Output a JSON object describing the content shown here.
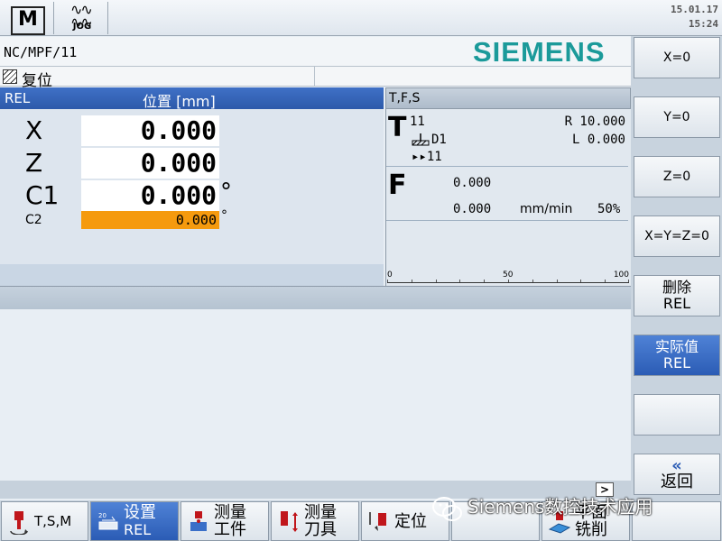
{
  "status": {
    "mode_icon": "M",
    "jog_label": "JOG",
    "date": "15.01.17",
    "time": "15:24"
  },
  "program": {
    "path": "NC/MPF/11",
    "brand": "SIEMENS",
    "reset_label": "复位"
  },
  "position": {
    "header_label": "REL",
    "header_unit": "位置 [mm]",
    "axes": [
      {
        "name": "X",
        "value": "0.000",
        "unit": ""
      },
      {
        "name": "Z",
        "value": "0.000",
        "unit": ""
      },
      {
        "name": "C1",
        "value": "0.000",
        "unit": "°"
      }
    ],
    "c2": {
      "name": "C2",
      "value": "0.000",
      "unit": "°"
    }
  },
  "tfs": {
    "header": "T,F,S",
    "t_letter": "T",
    "tool_number": "11",
    "edge": "D1",
    "next_tool": "▸▸11",
    "radius": "R 10.000",
    "length": "L  0.000",
    "f_letter": "F",
    "feed_actual": "0.000",
    "feed_set": "0.000",
    "feed_unit": "mm/min",
    "feed_override": "50%",
    "scale": {
      "min": "0",
      "mid": "50",
      "max": "100"
    }
  },
  "softkeys_vertical": [
    {
      "line1": "X=0",
      "line2": "",
      "active": false
    },
    {
      "line1": "Y=0",
      "line2": "",
      "active": false
    },
    {
      "line1": "Z=0",
      "line2": "",
      "active": false
    },
    {
      "line1": "X=Y=Z=0",
      "line2": "",
      "active": false
    },
    {
      "line1": "删除",
      "line2": "REL",
      "active": false
    },
    {
      "line1": "实际值",
      "line2": "REL",
      "active": true
    },
    {
      "line1": "",
      "line2": "",
      "active": false
    },
    {
      "line1": "«",
      "line2": "返回",
      "active": false
    }
  ],
  "softkeys_horizontal": [
    {
      "line1": "T,S,M",
      "line2": "",
      "icon": "tsm-icon",
      "active": false
    },
    {
      "line1": "设置",
      "line2": "REL",
      "icon": "set-rel-icon",
      "active": true
    },
    {
      "line1": "测量",
      "line2": "工件",
      "icon": "measure-workpiece-icon",
      "active": false
    },
    {
      "line1": "测量",
      "line2": "刀具",
      "icon": "measure-tool-icon",
      "active": false
    },
    {
      "line1": "定位",
      "line2": "",
      "icon": "position-icon",
      "active": false
    },
    {
      "line1": "",
      "line2": "",
      "icon": "",
      "active": false
    },
    {
      "line1": "平面",
      "line2": "铣削",
      "icon": "face-milling-icon",
      "active": false
    },
    {
      "line1": "",
      "line2": "",
      "icon": "",
      "active": false
    }
  ],
  "scroll_label": ">",
  "watermark": "Siemens数控技术应用"
}
